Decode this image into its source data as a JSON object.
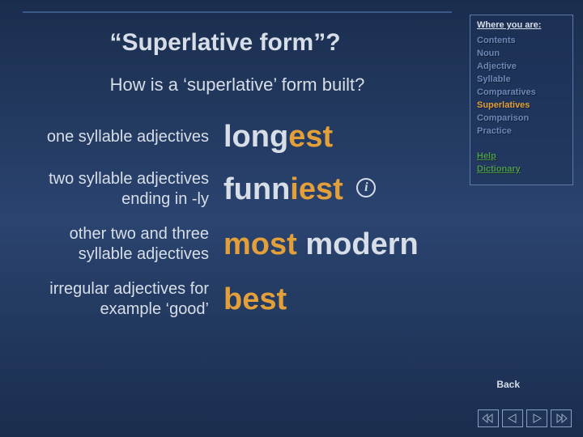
{
  "title": "“Superlative form”?",
  "subtitle": "How is a ‘superlative’ form built?",
  "rows": [
    {
      "label": "one syllable adjectives",
      "stem": "long",
      "suffix": "est"
    },
    {
      "label": "two syllable adjectives ending in -ly",
      "stem": "funn",
      "suffix": "iest",
      "info": true
    },
    {
      "label": "other two and three syllable adjectives",
      "most": "most",
      "word": "modern"
    },
    {
      "label": "irregular adjectives for example ‘good’",
      "irregular": "best"
    }
  ],
  "sidebar": {
    "heading": "Where you are:",
    "crumbs": [
      {
        "label": "Contents",
        "active": false
      },
      {
        "label": "Noun",
        "active": false
      },
      {
        "label": "Adjective",
        "active": false
      },
      {
        "label": "Syllable",
        "active": false
      },
      {
        "label": "Comparatives",
        "active": false
      },
      {
        "label": "Superlatives",
        "active": true
      },
      {
        "label": "Comparison",
        "active": false
      },
      {
        "label": "Practice",
        "active": false
      }
    ],
    "links": [
      {
        "label": "Help"
      },
      {
        "label": "Dictionary"
      }
    ]
  },
  "back": "Back"
}
